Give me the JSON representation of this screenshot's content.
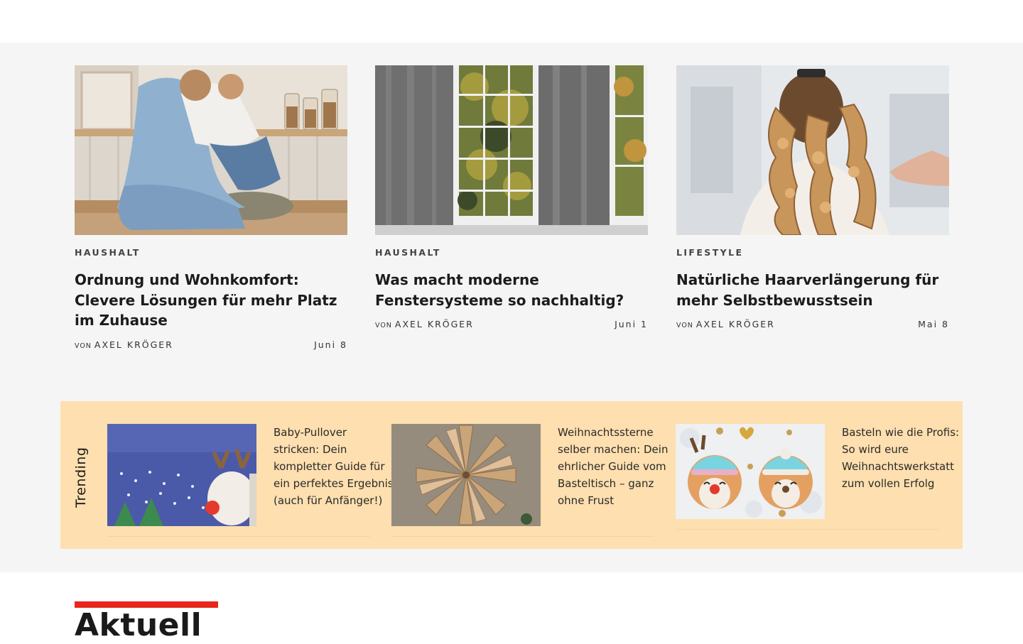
{
  "articles": [
    {
      "category": "HAUSHALT",
      "title": "Ordnung und Wohnkomfort: Clevere Lösungen für mehr Platz im Zuhause",
      "by": "VON",
      "author": "AXEL KRÖGER",
      "date": "Juni 8"
    },
    {
      "category": "HAUSHALT",
      "title": "Was macht moderne Fenstersysteme so nachhaltig?",
      "by": "VON",
      "author": "AXEL KRÖGER",
      "date": "Juni 1"
    },
    {
      "category": "LIFESTYLE",
      "title": "Natürliche Haarverlängerung für mehr Selbstbewusstsein",
      "by": "VON",
      "author": "AXEL KRÖGER",
      "date": "Mai 8"
    }
  ],
  "trending": {
    "label": "Trending",
    "items": [
      {
        "title": "Baby-Pullover stricken: Dein kompletter Guide für ein perfektes Ergebnis (auch für Anfänger!)"
      },
      {
        "title": "Weihnachtssterne selber machen: Dein ehrlicher Guide vom Basteltisch – ganz ohne Frust"
      },
      {
        "title": "Basteln wie die Profis: So wird eure Weihnachtswerkstatt zum vollen Erfolg"
      }
    ]
  },
  "aktuell": {
    "title": "Aktuell"
  },
  "colors": {
    "band": "#f5f5f5",
    "trending_bg": "#fedfaf",
    "accent": "#e8261b"
  }
}
